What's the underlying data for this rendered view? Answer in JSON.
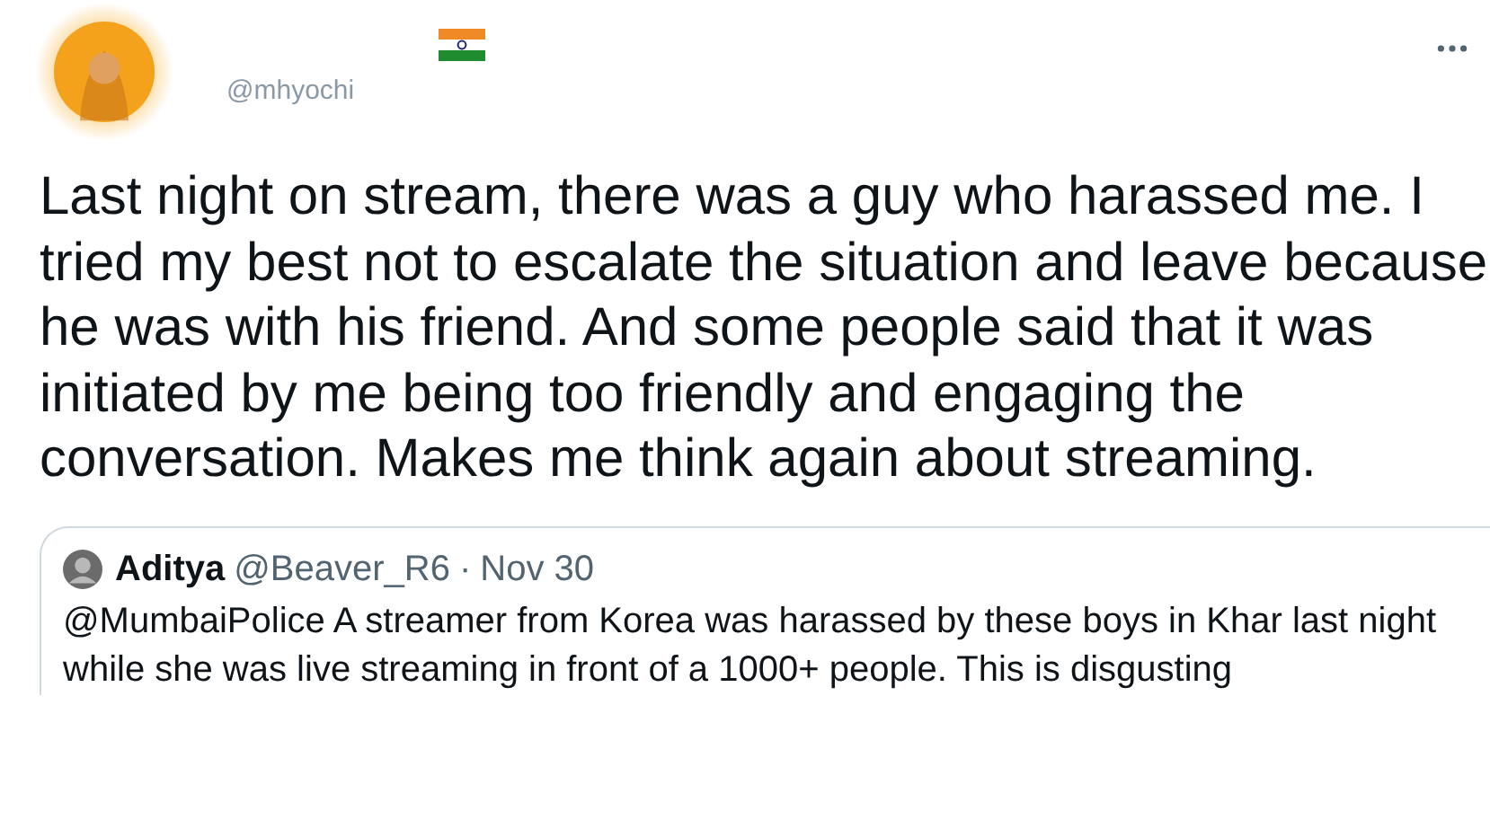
{
  "tweet": {
    "handle": "@mhyochi",
    "text": "Last night on stream, there was a guy who harassed me. I tried my best not to escalate the situation and leave because he was with his friend. And some people said that it was initiated by me being too friendly and engaging the conversation. Makes me think again about streaming."
  },
  "quoted_tweet": {
    "name": "Aditya",
    "handle": "@Beaver_R6",
    "separator": "·",
    "date": "Nov 30",
    "text": "@MumbaiPolice A streamer from Korea was harassed by these boys in Khar last night while she was live streaming in front of a 1000+ people. This is disgusting"
  }
}
